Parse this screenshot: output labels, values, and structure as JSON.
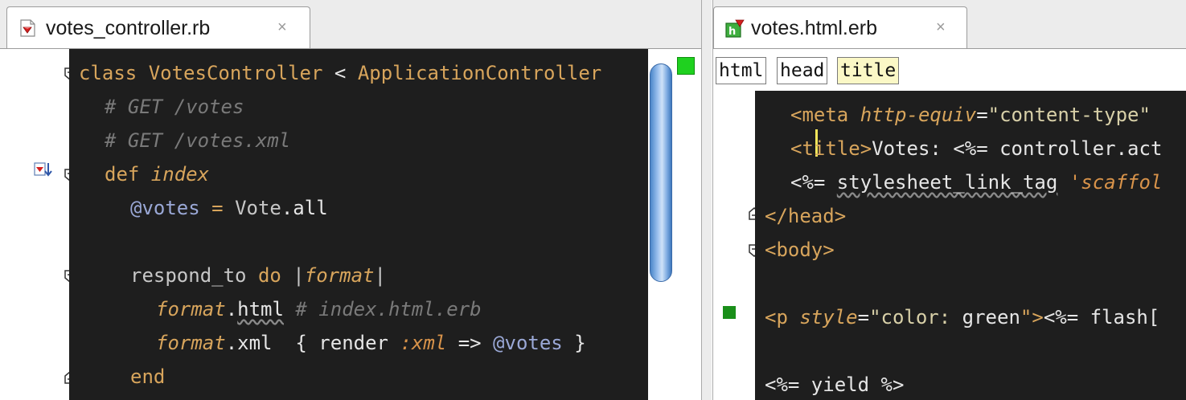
{
  "left_tab": {
    "label": "votes_controller.rb",
    "close": "×",
    "icon": "ruby-file-icon"
  },
  "left_code": [
    {
      "indent": 0,
      "tokens": [
        {
          "t": "class ",
          "c": "k"
        },
        {
          "t": "VotesController",
          "c": "k"
        },
        {
          "t": " < ",
          "c": "w"
        },
        {
          "t": "ApplicationController",
          "c": "k"
        }
      ]
    },
    {
      "indent": 1,
      "tokens": [
        {
          "t": "# GET /votes",
          "c": "c"
        }
      ]
    },
    {
      "indent": 1,
      "tokens": [
        {
          "t": "# GET /votes.xml",
          "c": "c"
        }
      ]
    },
    {
      "indent": 1,
      "tokens": [
        {
          "t": "def ",
          "c": "k"
        },
        {
          "t": "index",
          "c": "pa"
        }
      ]
    },
    {
      "indent": 2,
      "tokens": [
        {
          "t": "@votes",
          "c": "iv"
        },
        {
          "t": " = ",
          "c": "k"
        },
        {
          "t": "Vote",
          "c": "t"
        },
        {
          "t": ".all",
          "c": "w"
        }
      ]
    },
    {
      "indent": 0,
      "tokens": []
    },
    {
      "indent": 2,
      "tokens": [
        {
          "t": "respond_to ",
          "c": "t"
        },
        {
          "t": "do",
          "c": "k"
        },
        {
          "t": " |",
          "c": "t"
        },
        {
          "t": "format",
          "c": "pa"
        },
        {
          "t": "|",
          "c": "t"
        }
      ]
    },
    {
      "indent": 3,
      "tokens": [
        {
          "t": "format",
          "c": "pa"
        },
        {
          "t": ".",
          "c": "w"
        },
        {
          "t": "html",
          "c": "w sq"
        },
        {
          "t": " # index.html.erb",
          "c": "c"
        }
      ]
    },
    {
      "indent": 3,
      "tokens": [
        {
          "t": "format",
          "c": "pa"
        },
        {
          "t": ".xml  { render ",
          "c": "w"
        },
        {
          "t": ":xml",
          "c": "sym"
        },
        {
          "t": " => ",
          "c": "w"
        },
        {
          "t": "@votes",
          "c": "iv"
        },
        {
          "t": " }",
          "c": "w"
        }
      ]
    },
    {
      "indent": 2,
      "tokens": [
        {
          "t": "end",
          "c": "k"
        }
      ]
    }
  ],
  "right_tab": {
    "label": "votes.html.erb",
    "close": "×",
    "icon": "erb-file-icon"
  },
  "breadcrumbs": [
    {
      "label": "html",
      "selected": false
    },
    {
      "label": "head",
      "selected": false
    },
    {
      "label": "title",
      "selected": true
    }
  ],
  "right_code": [
    {
      "indent": 2,
      "tokens": [
        {
          "t": "<meta ",
          "c": "tg"
        },
        {
          "t": "http-equiv",
          "c": "at"
        },
        {
          "t": "=",
          "c": "w"
        },
        {
          "t": "\"content-type\"",
          "c": "st"
        }
      ]
    },
    {
      "indent": 2,
      "tokens": [
        {
          "t": "<title>",
          "c": "tg"
        },
        {
          "t": "Votes: ",
          "c": "w"
        },
        {
          "t": "<%= ",
          "c": "er"
        },
        {
          "t": "controller.act",
          "c": "w"
        }
      ]
    },
    {
      "indent": 2,
      "tokens": [
        {
          "t": "<%= ",
          "c": "er"
        },
        {
          "t": "stylesheet_link_tag",
          "c": "w sq"
        },
        {
          "t": " ",
          "c": "w"
        },
        {
          "t": "'scaffol",
          "c": "sym"
        }
      ]
    },
    {
      "indent": 0,
      "tokens": [
        {
          "t": "</head>",
          "c": "tg"
        }
      ]
    },
    {
      "indent": 0,
      "tokens": [
        {
          "t": "<body>",
          "c": "tg"
        }
      ]
    },
    {
      "indent": 0,
      "tokens": []
    },
    {
      "indent": 0,
      "tokens": [
        {
          "t": "<p ",
          "c": "tg"
        },
        {
          "t": "style",
          "c": "at"
        },
        {
          "t": "=",
          "c": "w"
        },
        {
          "t": "\"color: ",
          "c": "st"
        },
        {
          "t": "green",
          "c": "w"
        },
        {
          "t": "\">",
          "c": "tg"
        },
        {
          "t": "<%= ",
          "c": "er"
        },
        {
          "t": "flash[",
          "c": "w"
        }
      ]
    },
    {
      "indent": 0,
      "tokens": []
    },
    {
      "indent": 0,
      "tokens": [
        {
          "t": "<%= ",
          "c": "er"
        },
        {
          "t": "yield ",
          "c": "w"
        },
        {
          "t": "%>",
          "c": "er"
        }
      ]
    }
  ]
}
